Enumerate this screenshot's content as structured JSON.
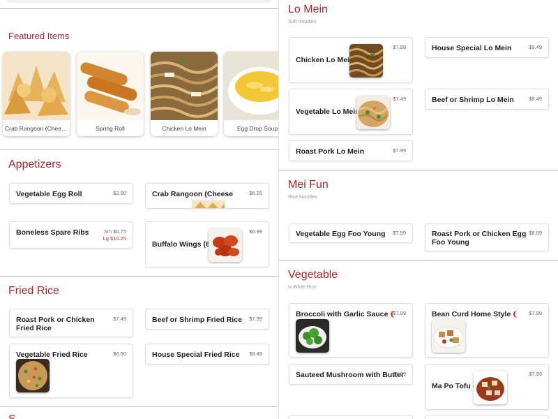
{
  "colors": {
    "accent": "#b0222c",
    "divider": "#b9b9b9",
    "price": "#666666",
    "price_large": "#c0302a",
    "chili": "#cc2a1a"
  },
  "featured": {
    "title": "Featured Items",
    "items": [
      {
        "label": "Crab Rangoon (Cheese...",
        "icon": "crab-rangoon-photo"
      },
      {
        "label": "Spring Roll",
        "icon": "spring-roll-photo"
      },
      {
        "label": "Chicken Lo Mein",
        "icon": "lo-mein-photo"
      },
      {
        "label": "Egg Drop Soup",
        "icon": "egg-drop-soup-photo"
      }
    ]
  },
  "appetizers": {
    "title": "Appetizers",
    "items": [
      {
        "name": "Vegetable Egg Roll",
        "price": "$2.50"
      },
      {
        "name": "Crab Rangoon (Cheese",
        "price": "$6.25"
      },
      {
        "name": "Boneless Spare Ribs",
        "price_sm": "Sm $6.75",
        "price_lg": "Lg $10.25"
      },
      {
        "name": "Buffalo Wings (6)",
        "price": "$6.99"
      }
    ]
  },
  "fried_rice": {
    "title": "Fried Rice",
    "items": [
      {
        "name": "Roast Pork or Chicken Fried Rice",
        "price": "$7.49"
      },
      {
        "name": "Beef or Shrimp Fried Rice",
        "price": "$7.99"
      },
      {
        "name": "Vegetable Fried Rice",
        "price": "$6.50"
      },
      {
        "name": "House Special Fried Rice",
        "price": "$8.49"
      }
    ]
  },
  "lo_mein": {
    "title": "Lo Mein",
    "subtitle": "Soft Noodles",
    "items": [
      {
        "name": "Chicken Lo Mein",
        "price": "$7.99"
      },
      {
        "name": "House Special Lo Mein",
        "price": "$9.49"
      },
      {
        "name": "Vegetable Lo Mein",
        "price": "$7.49"
      },
      {
        "name": "Beef or Shrimp Lo Mein",
        "price": "$8.49"
      },
      {
        "name": "Roast Pork Lo Mein",
        "price": "$7.99"
      }
    ]
  },
  "mei_fun": {
    "title": "Mei Fun",
    "subtitle": "Rice Noodles",
    "items": [
      {
        "name": "Vegetable Egg Foo Young",
        "price": "$7.99"
      },
      {
        "name": "Roast Pork or Chicken Egg Foo Young",
        "price": "$8.99"
      }
    ]
  },
  "vegetable": {
    "title": "Vegetable",
    "subtitle": "w White Rice",
    "items": [
      {
        "name": "Broccoli with Garlic Sauce",
        "price": "$7.99",
        "spicy": "❯"
      },
      {
        "name": "Bean Curd Home Style",
        "price": "$7.99",
        "spicy": "❯"
      },
      {
        "name": "Sauteed Mushroom with Butter",
        "price": "$7.99"
      },
      {
        "name": "Ma Po Tofu",
        "price": "$7.99",
        "spicy": "❯"
      }
    ]
  },
  "partial_next_section": {
    "title": "S"
  }
}
